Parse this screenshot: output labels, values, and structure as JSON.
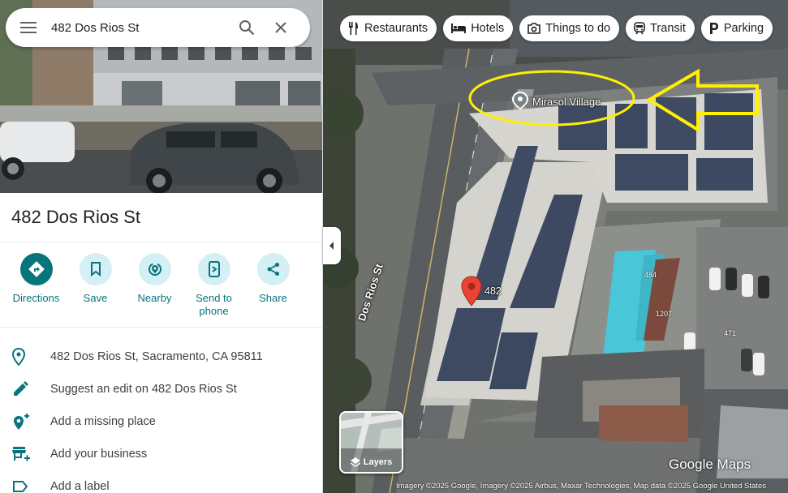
{
  "search": {
    "value": "482 Dos Rios St",
    "menu_icon": "menu-icon",
    "search_icon": "search-icon",
    "clear_icon": "close-icon"
  },
  "place": {
    "title": "482 Dos Rios St",
    "actions": [
      {
        "label": "Directions",
        "icon": "directions-icon"
      },
      {
        "label": "Save",
        "icon": "bookmark-icon"
      },
      {
        "label": "Nearby",
        "icon": "nearby-icon"
      },
      {
        "label": "Send to\nphone",
        "icon": "send-to-phone-icon"
      },
      {
        "label": "Share",
        "icon": "share-icon"
      }
    ],
    "info": [
      {
        "text": "482 Dos Rios St, Sacramento, CA 95811",
        "icon": "location-pin-icon"
      },
      {
        "text": "Suggest an edit on 482 Dos Rios St",
        "icon": "pencil-icon"
      },
      {
        "text": "Add a missing place",
        "icon": "add-place-icon"
      },
      {
        "text": "Add your business",
        "icon": "add-business-icon"
      },
      {
        "text": "Add a label",
        "icon": "label-icon"
      }
    ]
  },
  "map": {
    "chips": [
      {
        "label": "Restaurants",
        "icon": "fork-knife-icon"
      },
      {
        "label": "Hotels",
        "icon": "bed-icon"
      },
      {
        "label": "Things to do",
        "icon": "camera-icon"
      },
      {
        "label": "Transit",
        "icon": "train-icon"
      },
      {
        "label": "Parking",
        "icon": "parking-icon"
      }
    ],
    "poi_label": "Mirasol Village",
    "marker_label": "482",
    "street_label": "Dos Rios St",
    "address_numbers": [
      "484",
      "1207",
      "471"
    ],
    "layers_label": "Layers",
    "watermark": "Google Maps",
    "attribution": "Imagery ©2025 Google, Imagery ©2025 Airbus, Maxar Technologies, Map data ©2025 Google    United States",
    "colors": {
      "accent": "#08747c",
      "accent_light": "#d4f0f5",
      "marker_red": "#ea4335",
      "annotation_yellow": "#ffef00"
    }
  }
}
